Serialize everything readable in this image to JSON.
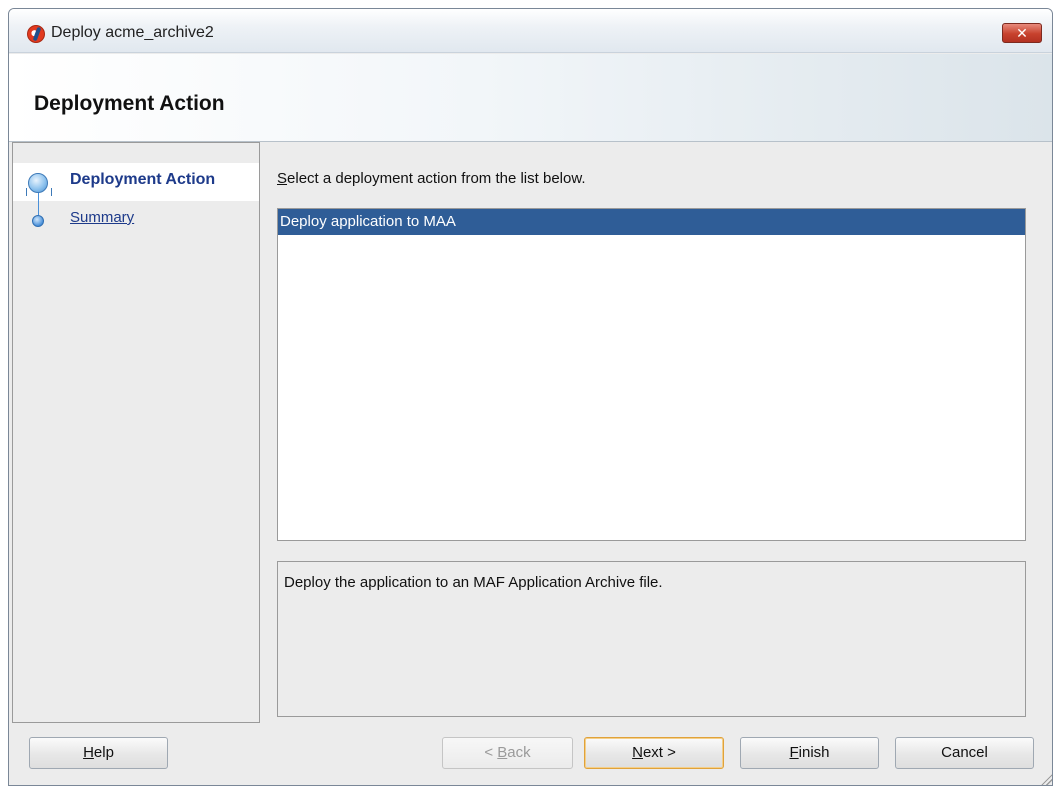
{
  "window": {
    "title": "Deploy acme_archive2",
    "close_glyph": "✕"
  },
  "header": {
    "title": "Deployment Action"
  },
  "sidebar": {
    "steps": [
      {
        "label": "Deployment Action",
        "active": true,
        "icon": "step-current-icon"
      },
      {
        "label": "Summary",
        "active": false,
        "icon": "step-pending-icon"
      }
    ]
  },
  "main": {
    "instruction_mnemonic": "S",
    "instruction_rest": "elect a deployment action from the list below.",
    "actions": [
      {
        "label": "Deploy application to MAA",
        "selected": true
      }
    ],
    "description": "Deploy the application to an MAF Application Archive file."
  },
  "footer": {
    "help": {
      "mn": "H",
      "rest": "elp"
    },
    "back": {
      "pre": "< ",
      "mn": "B",
      "rest": "ack",
      "enabled": false
    },
    "next": {
      "mn": "N",
      "rest": "ext >",
      "default": true
    },
    "finish": {
      "mn": "F",
      "rest": "inish"
    },
    "cancel": {
      "label": "Cancel"
    }
  },
  "colors": {
    "selection": "#2f5d97",
    "link": "#1d3a8a",
    "default_button_border": "#e0a23a"
  }
}
